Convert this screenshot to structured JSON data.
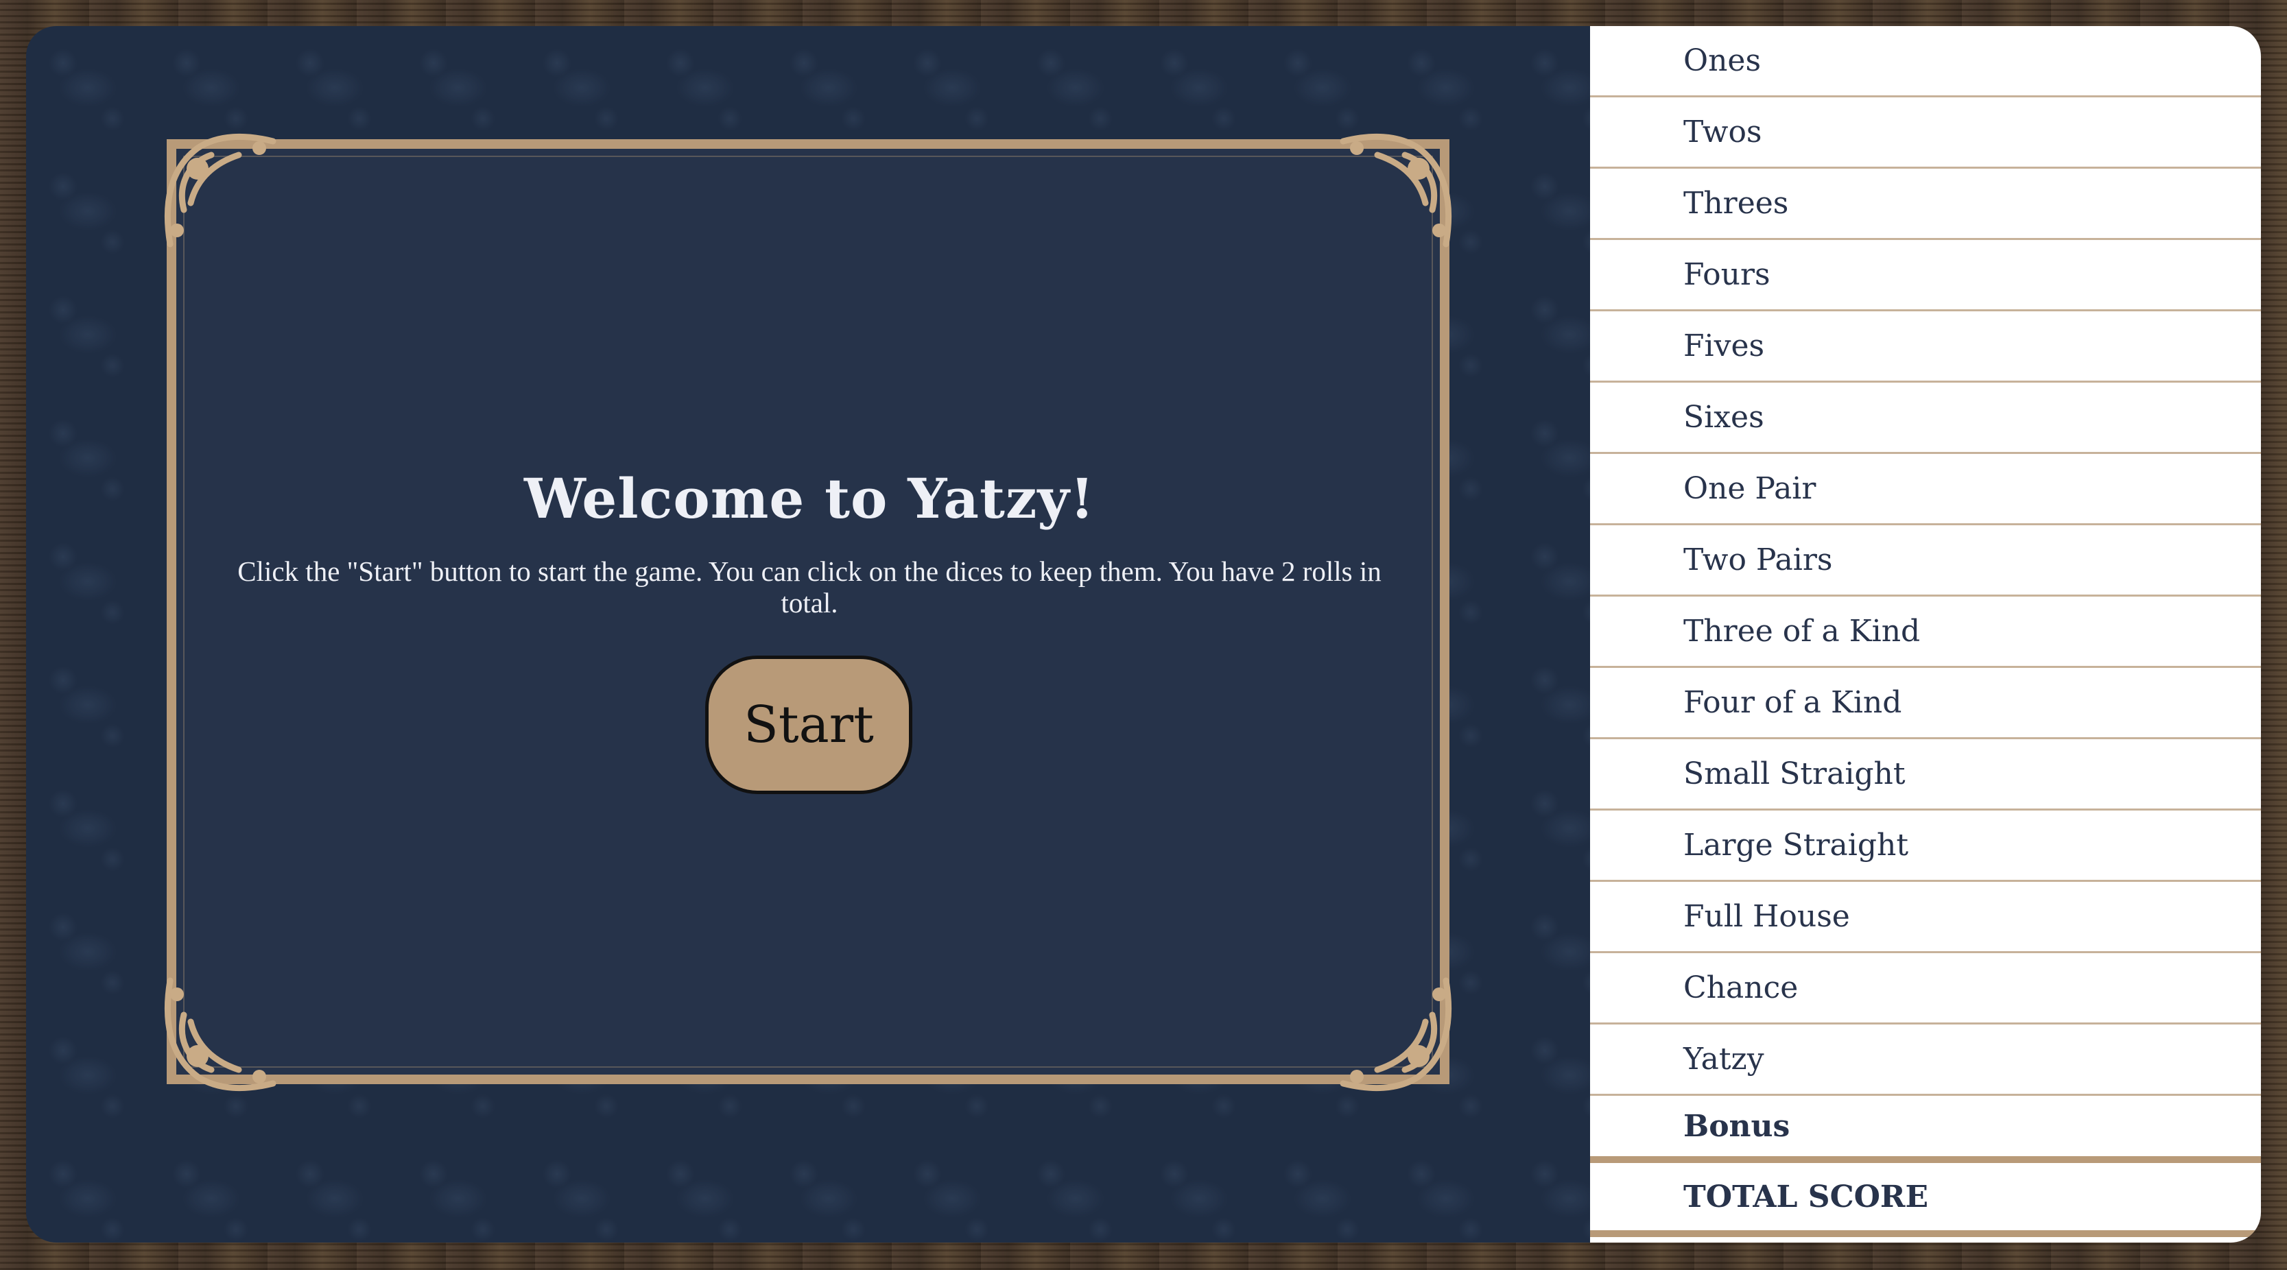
{
  "welcome": {
    "title": "Welcome to Yatzy!",
    "text": "Click the \"Start\" button to start the game. You can click on the dices to keep them. You have 2 rolls in total.",
    "start_label": "Start"
  },
  "scorecard": {
    "rows": [
      {
        "label": "Ones"
      },
      {
        "label": "Twos"
      },
      {
        "label": "Threes"
      },
      {
        "label": "Fours"
      },
      {
        "label": "Fives"
      },
      {
        "label": "Sixes"
      },
      {
        "label": "One Pair"
      },
      {
        "label": "Two Pairs"
      },
      {
        "label": "Three of a Kind"
      },
      {
        "label": "Four of a Kind"
      },
      {
        "label": "Small Straight"
      },
      {
        "label": "Large Straight"
      },
      {
        "label": "Full House"
      },
      {
        "label": "Chance"
      },
      {
        "label": "Yatzy"
      }
    ],
    "bonus_label": "Bonus",
    "total_label": "TOTAL SCORE"
  },
  "colors": {
    "board": "#1f2d43",
    "frame_gold": "#b89a78",
    "panel": "#26334a",
    "text_dark": "#28334b",
    "wood": "#4b3a2c"
  },
  "icons": [
    "ornament-corner-icon"
  ]
}
